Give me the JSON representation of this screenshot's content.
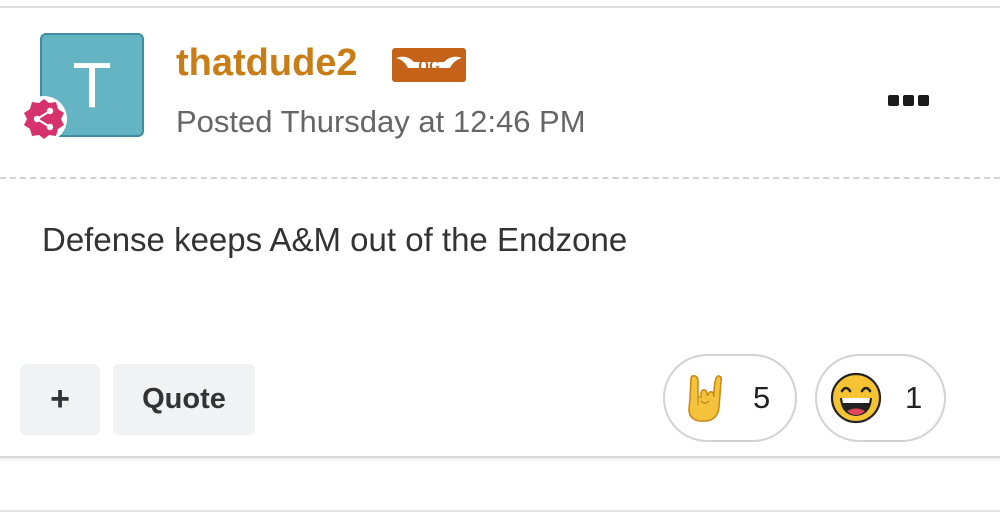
{
  "post": {
    "author": {
      "name": "thatdude2",
      "avatar_letter": "T",
      "avatar_color": "#65b4c4",
      "group_icon": "share-network-icon",
      "group_badge_color": "#d6336c",
      "badge_text": "OG",
      "badge_color": "#c4621a"
    },
    "date": "Posted Thursday at 12:46 PM",
    "more_icon": "ellipsis-icon",
    "body": "Defense keeps A&M out of the Endzone"
  },
  "actions": {
    "multiquote_label": "+",
    "quote_label": "Quote"
  },
  "reactions": [
    {
      "icon": "rock-on-hand-icon",
      "count": "5"
    },
    {
      "icon": "laughing-face-icon",
      "count": "1"
    }
  ],
  "colors": {
    "author_name": "#c97d17",
    "text": "#333333",
    "muted": "#666666"
  }
}
